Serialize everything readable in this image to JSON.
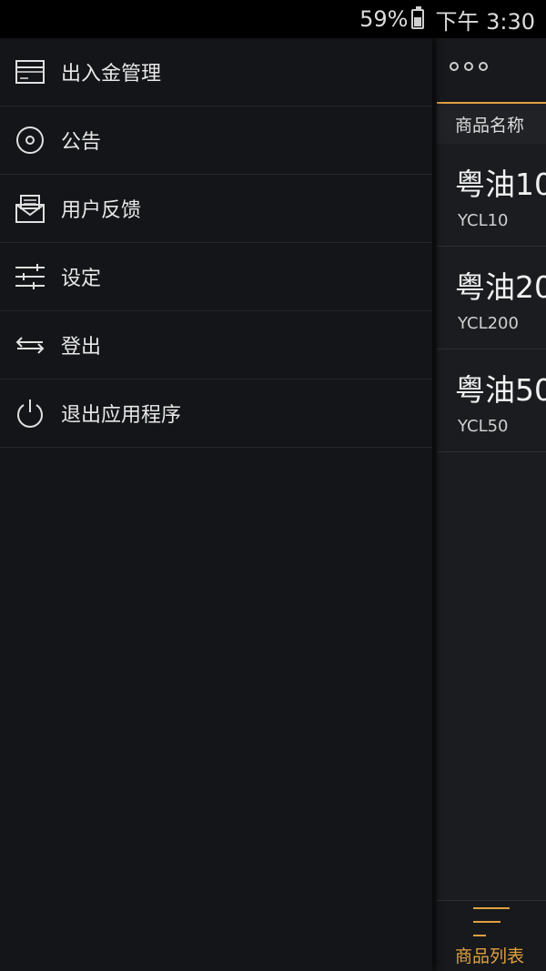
{
  "status": {
    "battery": "59%",
    "time": "下午 3:30"
  },
  "drawer": {
    "items": [
      {
        "label": "出入金管理",
        "icon": "card-icon"
      },
      {
        "label": "公告",
        "icon": "circle-dot-icon"
      },
      {
        "label": "用户反馈",
        "icon": "envelope-icon"
      },
      {
        "label": "设定",
        "icon": "sliders-icon"
      },
      {
        "label": "登出",
        "icon": "arrows-icon"
      },
      {
        "label": "退出应用程序",
        "icon": "power-icon"
      }
    ]
  },
  "right": {
    "column_header": "商品名称",
    "products": [
      {
        "name": "粤油10",
        "code": "YCL10"
      },
      {
        "name": "粤油20",
        "code": "YCL200"
      },
      {
        "name": "粤油50",
        "code": "YCL50"
      }
    ],
    "bottom_nav_label": "商品列表"
  },
  "colors": {
    "accent": "#e0a040",
    "background": "#141518"
  }
}
